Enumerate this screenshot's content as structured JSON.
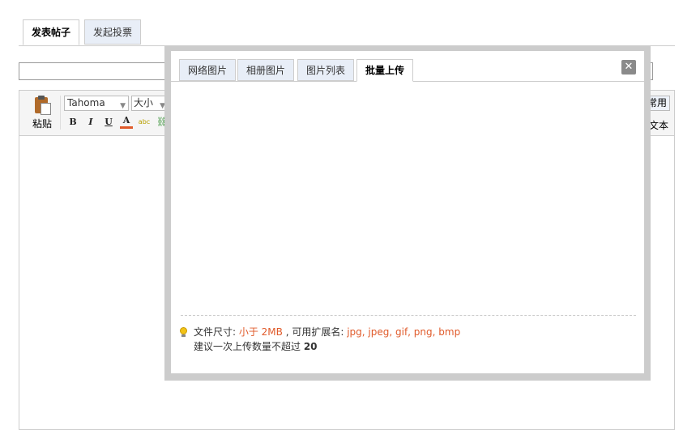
{
  "top_tabs": [
    {
      "label": "发表帖子",
      "active": true
    },
    {
      "label": "发起投票",
      "active": false
    }
  ],
  "toolbar": {
    "paste_label": "粘贴",
    "font_value": "Tahoma",
    "size_value": "大小",
    "format_buttons": [
      "B",
      "I",
      "U",
      "A"
    ],
    "highlight_glyph": "abc",
    "link_glyph": "⛓",
    "common_label": "常用",
    "plaintext_label": "纯文本"
  },
  "modal": {
    "tabs": [
      {
        "label": "网络图片",
        "active": false
      },
      {
        "label": "相册图片",
        "active": false
      },
      {
        "label": "图片列表",
        "active": false
      },
      {
        "label": "批量上传",
        "active": true
      }
    ],
    "close_glyph": "✕",
    "tip": {
      "size_label": "文件尺寸: ",
      "size_value": "小于 2MB",
      "ext_label": " , 可用扩展名: ",
      "ext_value": "jpg, jpeg, gif, png, bmp",
      "count_text": "建议一次上传数量不超过 ",
      "count_value": "20"
    }
  },
  "colors": {
    "accent_red": "#e05a2a",
    "tab_bg": "#e8eef7",
    "frame": "#cccccc"
  },
  "icons": [
    "paste-icon",
    "highlight-icon",
    "link-icon",
    "close-icon",
    "lightbulb-icon"
  ]
}
